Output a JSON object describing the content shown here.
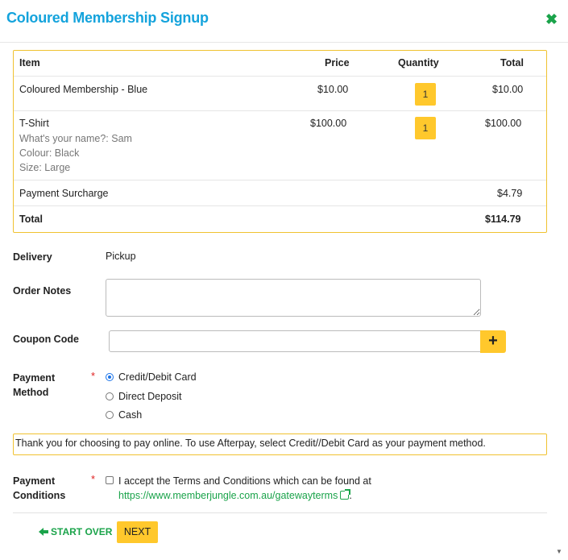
{
  "header": {
    "title": "Coloured Membership Signup",
    "close_symbol": "✖"
  },
  "cart": {
    "columns": {
      "item": "Item",
      "price": "Price",
      "quantity": "Quantity",
      "total": "Total"
    },
    "rows": [
      {
        "item": "Coloured Membership - Blue",
        "price": "$10.00",
        "quantity": "1",
        "total": "$10.00",
        "details": []
      },
      {
        "item": "T-Shirt",
        "price": "$100.00",
        "quantity": "1",
        "total": "$100.00",
        "details": [
          "What's your name?: Sam",
          "Colour: Black",
          "Size: Large"
        ]
      }
    ],
    "surcharge": {
      "label": "Payment Surcharge",
      "total": "$4.79"
    },
    "grand_total": {
      "label": "Total",
      "total": "$114.79"
    }
  },
  "form": {
    "delivery": {
      "label": "Delivery",
      "value": "Pickup"
    },
    "order_notes": {
      "label": "Order Notes",
      "value": ""
    },
    "coupon": {
      "label": "Coupon Code",
      "value": "",
      "button_symbol": "+"
    },
    "payment_method": {
      "label_line1": "Payment",
      "label_line2": "Method",
      "required_mark": "*",
      "options": [
        {
          "label": "Credit/Debit Card",
          "selected": true
        },
        {
          "label": "Direct Deposit",
          "selected": false
        },
        {
          "label": "Cash",
          "selected": false
        }
      ]
    },
    "notice": "Thank you for choosing to pay online. To use Afterpay, select Credit//Debit Card as your payment method.",
    "payment_conditions": {
      "label_line1": "Payment",
      "label_line2": "Conditions",
      "required_mark": "*",
      "text": "I accept the Terms and Conditions which can be found at",
      "link": "https://www.memberjungle.com.au/gatewayterms",
      "suffix": "."
    }
  },
  "footer": {
    "start_over": "START OVER",
    "next": "NEXT",
    "scroll_down_symbol": "▼"
  },
  "colors": {
    "accent_blue": "#14a3dc",
    "accent_green": "#1aa34a",
    "button_yellow": "#ffc82c",
    "border_gold": "#f0c230"
  },
  "icons": [
    "close-icon",
    "plus-icon",
    "arrow-left-icon",
    "external-link-icon"
  ]
}
